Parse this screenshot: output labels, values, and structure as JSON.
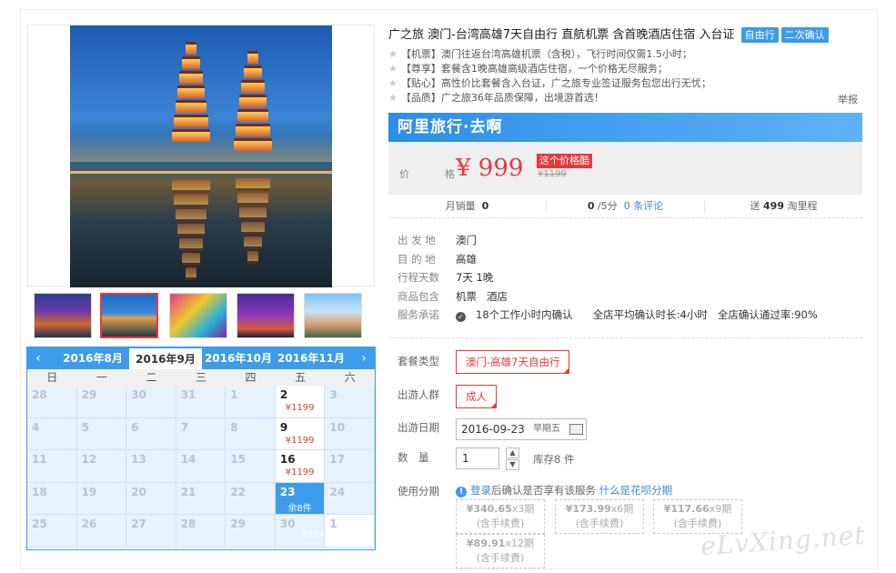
{
  "title": "广之旅 澳门-台湾高雄7天自由行 直航机票 含首晚酒店住宿 入台证",
  "tags": [
    "自由行",
    "二次确认"
  ],
  "perks": [
    "【机票】澳门往返台湾高雄机票（含税），飞行时间仅需1.5小时；",
    "【尊享】套餐含1晚高雄高级酒店住宿，一个价格无尽服务；",
    "【贴心】高性价比套餐含入台证，广之旅专业签证服务包您出行无忧；",
    "【品质】广之旅36年品质保障，出境游首选！"
  ],
  "report": "举报",
  "banner": "阿里旅行·去啊",
  "price": {
    "label": "价　格",
    "current": "¥ 999",
    "badge": "这个价格酷",
    "original": "¥1199"
  },
  "stats": {
    "sales_label": "月销量",
    "sales": "0",
    "rating": "0",
    "rating_suffix": "/5分",
    "reviews": "0 条评论",
    "points_prefix": "送",
    "points": "499",
    "points_suffix": "淘里程"
  },
  "info": {
    "from_label": "出 发 地",
    "from": "澳门",
    "to_label": "目 的 地",
    "to": "高雄",
    "days_label": "行程天数",
    "days": "7天 1晚",
    "includes_label": "商品包含",
    "includes": [
      "机票",
      "酒店"
    ],
    "promise_label": "服务承诺",
    "promises": [
      "18个工作小时内确认",
      "全店平均确认时长:4小时",
      "全店确认通过率:90%"
    ]
  },
  "options": {
    "package_label": "套餐类型",
    "package": "澳门-高雄7天自由行",
    "people_label": "出游人群",
    "people": "成人",
    "date_label": "出游日期",
    "date": "2016-09-23",
    "date_hint": "早期五",
    "qty_label": "数　量",
    "qty": "1",
    "stock": "库存8 件",
    "installment_label": "使用分期",
    "installment_note_link": "登录",
    "installment_note": "后确认是否享有该服务",
    "installment_help": "什么是花呗分期",
    "installments": [
      {
        "amount": "¥340.65",
        "periods": "x3期",
        "fee": "(含手续费)"
      },
      {
        "amount": "¥173.99",
        "periods": "x6期",
        "fee": "(含手续费)"
      },
      {
        "amount": "¥117.66",
        "periods": "x9期",
        "fee": "(含手续费)"
      },
      {
        "amount": "¥89.91",
        "periods": "x12期",
        "fee": "(含手续费)"
      }
    ]
  },
  "calendar": {
    "prev": "‹",
    "next": "›",
    "months": [
      "2016年8月",
      "2016年9月",
      "2016年10月",
      "2016年11月"
    ],
    "weekdays": [
      "日",
      "一",
      "二",
      "三",
      "四",
      "五",
      "六"
    ],
    "cells": [
      {
        "d": "28"
      },
      {
        "d": "29"
      },
      {
        "d": "30"
      },
      {
        "d": "31"
      },
      {
        "d": "1"
      },
      {
        "d": "2",
        "p": "¥1199",
        "s": "avail"
      },
      {
        "d": "3"
      },
      {
        "d": "4"
      },
      {
        "d": "5"
      },
      {
        "d": "6"
      },
      {
        "d": "7"
      },
      {
        "d": "8"
      },
      {
        "d": "9",
        "p": "¥1199",
        "s": "avail"
      },
      {
        "d": "10"
      },
      {
        "d": "11"
      },
      {
        "d": "12"
      },
      {
        "d": "13"
      },
      {
        "d": "14"
      },
      {
        "d": "15"
      },
      {
        "d": "16",
        "p": "¥1199",
        "s": "avail"
      },
      {
        "d": "17"
      },
      {
        "d": "18"
      },
      {
        "d": "19"
      },
      {
        "d": "20"
      },
      {
        "d": "21"
      },
      {
        "d": "22"
      },
      {
        "d": "23",
        "p": "余8件",
        "s": "sel"
      },
      {
        "d": "24"
      },
      {
        "d": "25"
      },
      {
        "d": "26"
      },
      {
        "d": "27"
      },
      {
        "d": "28"
      },
      {
        "d": "29"
      },
      {
        "d": "30",
        "g": "¥999"
      },
      {
        "d": "1",
        "s": "white"
      }
    ]
  },
  "watermark": "eLvXing.net"
}
